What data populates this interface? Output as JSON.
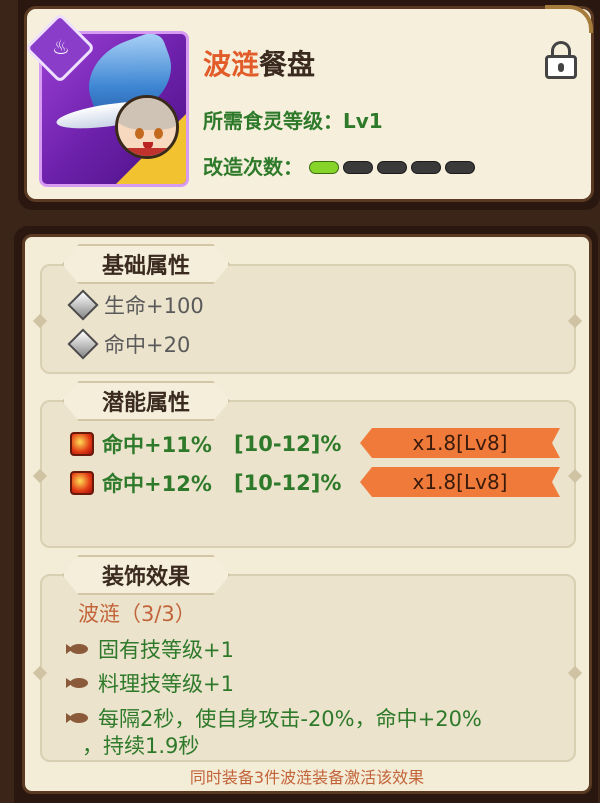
{
  "header": {
    "title_highlight": "波涟",
    "title_rest": "餐盘",
    "level_label": "所需食灵等级：",
    "level_value": "Lv1",
    "mod_label": "改造次数：",
    "mod_total": 5,
    "mod_filled": 1
  },
  "base_attrs": {
    "tab_label": "基础属性",
    "items": [
      {
        "label": "生命+100",
        "icon": "silver-diamond-icon"
      },
      {
        "label": "命中+20",
        "icon": "silver-diamond-icon"
      }
    ]
  },
  "potential_attrs": {
    "tab_label": "潜能属性",
    "items": [
      {
        "stat": "命中+11%",
        "range": "[10-12]%",
        "bonus": "x1.8[Lv8]",
        "icon": "red-gem-icon"
      },
      {
        "stat": "命中+12%",
        "range": "[10-12]%",
        "bonus": "x1.8[Lv8]",
        "icon": "red-gem-icon"
      }
    ]
  },
  "decor_effect": {
    "tab_label": "装饰效果",
    "set_name": "波涟（3/3）",
    "effects": [
      "固有技等级+1",
      "料理技等级+1",
      "每隔2秒，使自身攻击-20%，命中+20%",
      "，持续1.9秒"
    ],
    "footer": "同时装备3件波涟装备激活该效果"
  },
  "colors": {
    "title_highlight": "#e25c2a",
    "green_text": "#2e7a2a",
    "orange_text": "#c2643a",
    "bonus_ribbon": "#f07a3a",
    "portrait_border": "#d79bf2"
  }
}
